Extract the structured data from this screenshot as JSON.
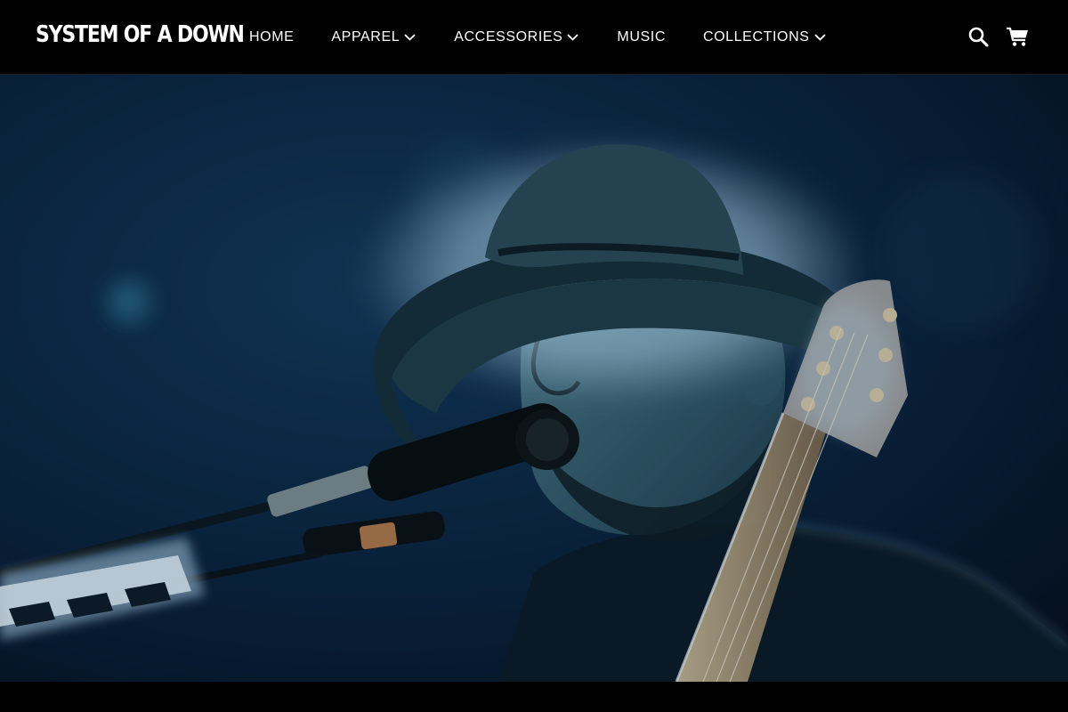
{
  "header": {
    "logo_text": "SYSTEM OF A DOWN",
    "nav": {
      "home": "HOME",
      "apparel": "APPAREL",
      "accessories": "ACCESSORIES",
      "music": "MUSIC",
      "collections": "COLLECTIONS"
    },
    "icons": {
      "search": "search-icon",
      "cart": "cart-icon",
      "dropdown": "chevron-down-icon"
    }
  },
  "hero": {
    "image": "singer-with-hat-at-microphone-holding-guitar"
  },
  "colors": {
    "header_bg": "#000000",
    "nav_text": "#ffffff",
    "hero_tint": "#0f3550"
  }
}
